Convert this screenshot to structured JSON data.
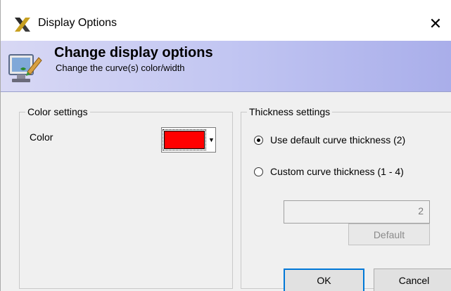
{
  "window": {
    "title": "Display Options",
    "close_glyph": "✕"
  },
  "icons": {
    "app": "x-logo-icon",
    "banner": "monitor-brush-icon",
    "close": "close-icon",
    "dropdown": "chevron-down-icon"
  },
  "banner": {
    "title": "Change display options",
    "subtitle": "Change the curve(s) color/width"
  },
  "color_settings": {
    "group_title": "Color settings",
    "color_label": "Color",
    "selected_color": "#ff0000",
    "dropdown_arrow": "▼"
  },
  "thickness_settings": {
    "group_title": "Thickness settings",
    "option_default": "Use default curve thickness (2)",
    "option_custom": "Custom curve thickness (1 - 4)",
    "selected_option": "default",
    "custom_value": "2",
    "default_button": "Default"
  },
  "footer": {
    "ok_button": "OK",
    "cancel_button": "Cancel"
  },
  "colors": {
    "banner_gradient_start": "#d8d8f4",
    "banner_gradient_end": "#a9aeea",
    "window_background": "#f0f0f0",
    "focus_border": "#0078d7"
  }
}
